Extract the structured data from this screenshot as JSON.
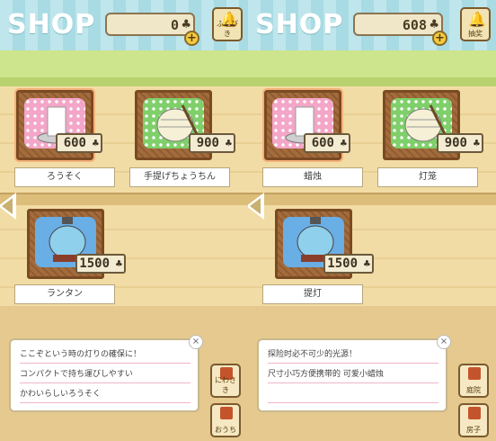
{
  "panels": [
    {
      "header": {
        "title": "SHOP",
        "coins": "0",
        "clover": "♣",
        "plus": "+",
        "right_button": "ふくびき"
      },
      "items": [
        {
          "label": "ろうそく",
          "price": "600",
          "cloth": "pink"
        },
        {
          "label": "手提げちょうちん",
          "price": "900",
          "cloth": "green"
        },
        {
          "label": "ランタン",
          "price": "1500",
          "cloth": "blue"
        }
      ],
      "description": [
        "ここぞという時の灯りの確保に！",
        "コンパクトで持ち運びしやすい",
        "かわいらしいろうそく"
      ],
      "side_buttons": [
        "にわさき",
        "おうち"
      ]
    },
    {
      "header": {
        "title": "SHOP",
        "coins": "608",
        "clover": "♣",
        "plus": "+",
        "right_button": "抽奖"
      },
      "items": [
        {
          "label": "蜡烛",
          "price": "600",
          "cloth": "pink"
        },
        {
          "label": "灯笼",
          "price": "900",
          "cloth": "green"
        },
        {
          "label": "提灯",
          "price": "1500",
          "cloth": "blue"
        }
      ],
      "description": [
        "探险时必不可少的光源！",
        "尺寸小巧方便携带的 可爱小蜡烛",
        ""
      ],
      "side_buttons": [
        "庭院",
        "房子"
      ]
    }
  ],
  "colors": {
    "header_stripe": "#bfe6ec",
    "grass": "#cde58c",
    "wall": "#f2dca5",
    "crate": "#a36b3c"
  }
}
